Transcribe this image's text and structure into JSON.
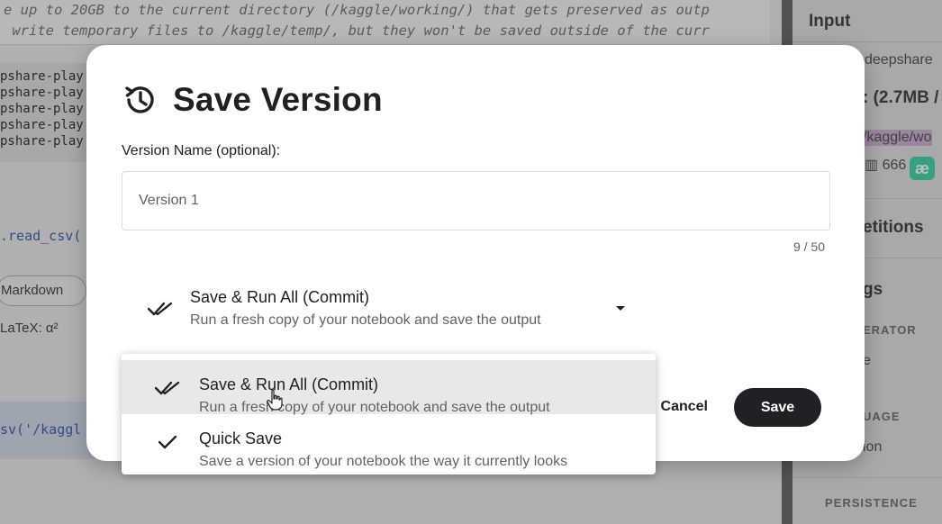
{
  "background": {
    "code_comment_lines": [
      "e up to 20GB to the current directory (/kaggle/working/) that gets preserved as outp",
      " write temporary files to /kaggle/temp/, but they won't be saved outside of the curr"
    ],
    "output_lines": [
      "pshare-play",
      "pshare-play",
      "pshare-play",
      "pshare-play",
      "pshare-play"
    ],
    "read_csv_fragment": ".read_csv(",
    "markdown_button": "Markdown",
    "latex_text": "LaTeX: α²",
    "csv_fragment": "sv('/kaggl",
    "panel": {
      "input_heading": "Input",
      "dataset_name": "deepshare",
      "size_text": ": (2.7MB /",
      "path_text": "/kaggle/wo",
      "count_text": "666",
      "competitions_heading": "etitions",
      "settings_heading": "gs",
      "accelerator_label": "ERATOR",
      "accelerator_value": "e",
      "language_label": "UAGE",
      "language_value": "ion",
      "persistence_label": "PERSISTENCE",
      "badge_text": "æ"
    }
  },
  "modal": {
    "title": "Save Version",
    "version_name_label": "Version Name (optional):",
    "version_name_value": "Version 1",
    "char_count": "9 / 50",
    "selected_option": {
      "title": "Save & Run All (Commit)",
      "description": "Run a fresh copy of your notebook and save the output"
    },
    "cancel_label": "Cancel",
    "save_label": "Save"
  },
  "menu": {
    "items": [
      {
        "title": "Save & Run All (Commit)",
        "description": "Run a fresh copy of your notebook and save the output",
        "icon": "double-check-icon",
        "hovered": true
      },
      {
        "title": "Quick Save",
        "description": "Save a version of your notebook the way it currently looks",
        "icon": "check-icon",
        "hovered": false
      }
    ]
  },
  "colors": {
    "primary_button": "#202124",
    "menu_hover": "#e8e8e8",
    "text_secondary": "#5f6368"
  }
}
